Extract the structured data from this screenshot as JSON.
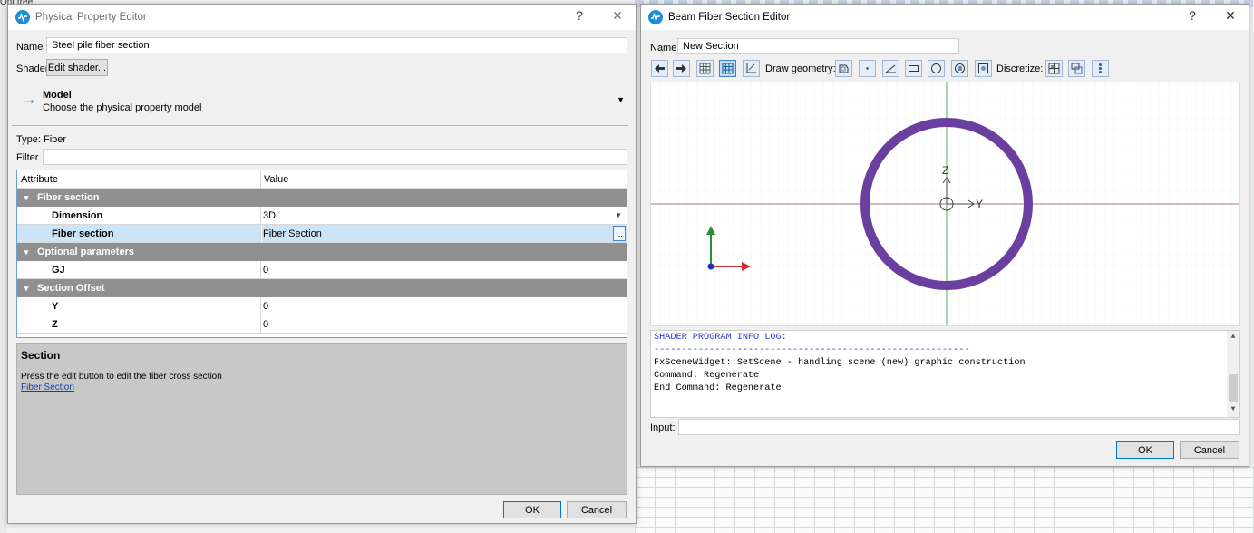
{
  "background": {
    "label_top": "Ont tree"
  },
  "ppe": {
    "title": "Physical Property Editor",
    "help": "?",
    "close": "✕",
    "name_label": "Name",
    "name_value": "Steel pile fiber section",
    "shader_label": "Shader",
    "edit_shader_label": "Edit shader...",
    "model": {
      "title": "Model",
      "subtitle": "Choose the physical property model"
    },
    "type_label": "Type:",
    "type_value": "Fiber",
    "filter_label": "Filter",
    "filter_value": "",
    "table": {
      "header_attribute": "Attribute",
      "header_value": "Value",
      "groups": {
        "fiber_section": "Fiber section",
        "optional_parameters": "Optional parameters",
        "section_offset": "Section Offset"
      },
      "rows": {
        "dimension": {
          "attr": "Dimension",
          "value": "3D"
        },
        "fiber_section": {
          "attr": "Fiber section",
          "value": "Fiber Section"
        },
        "gj": {
          "attr": "GJ",
          "value": "0"
        },
        "y": {
          "attr": "Y",
          "value": "0"
        },
        "z": {
          "attr": "Z",
          "value": "0"
        }
      }
    },
    "section": {
      "title": "Section",
      "description": "Press the edit button to edit the fiber cross section",
      "link": "Fiber Section"
    },
    "ok_label": "OK",
    "cancel_label": "Cancel"
  },
  "bfse": {
    "title": "Beam Fiber Section Editor",
    "help": "?",
    "close": "✕",
    "name_label": "Name:",
    "name_value": "New Section",
    "draw_geometry_label": "Draw geometry:",
    "discretize_label": "Discretize:",
    "canvas": {
      "axis_z": "Z",
      "axis_y": "Y",
      "ring_color": "#6a3fa0"
    },
    "console_lines": [
      "SHADER PROGRAM INFO LOG:",
      "---------------------------------------------------------",
      "FxSceneWidget::SetScene - handling scene (new) graphic construction",
      "Command: Regenerate",
      "End Command: Regenerate"
    ],
    "input_label": "Input:",
    "input_value": "",
    "ok_label": "OK",
    "cancel_label": "Cancel"
  }
}
